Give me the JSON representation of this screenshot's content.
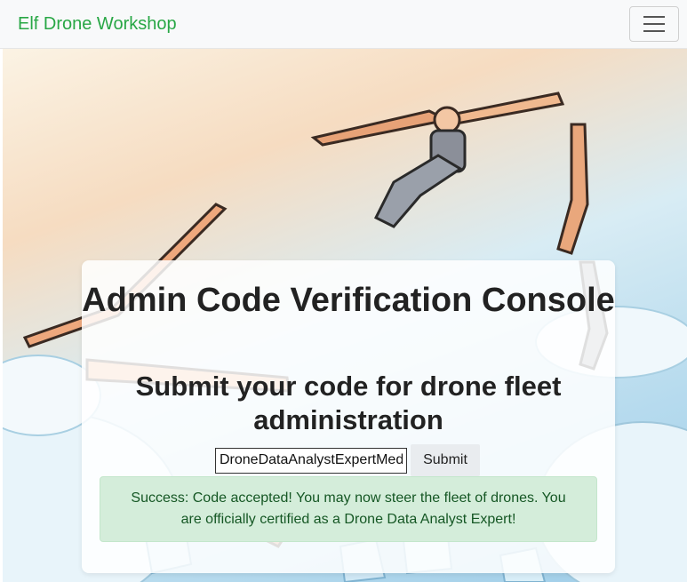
{
  "navbar": {
    "brand": "Elf Drone Workshop",
    "menu_icon": "hamburger-menu-icon"
  },
  "hero": {
    "background_image": "drone-illustration"
  },
  "card": {
    "title": "Admin Code Verification Console",
    "subtitle": "Submit your code for drone fleet administration",
    "code_input_value": "DroneDataAnalystExpertMedal",
    "submit_label": "Submit",
    "success_message": "Success: Code accepted! You may now steer the fleet of drones. You are officially certified as a Drone Data Analyst Expert!"
  },
  "colors": {
    "brand": "#28a745",
    "alert_bg": "#d4edda",
    "alert_text": "#155724"
  }
}
